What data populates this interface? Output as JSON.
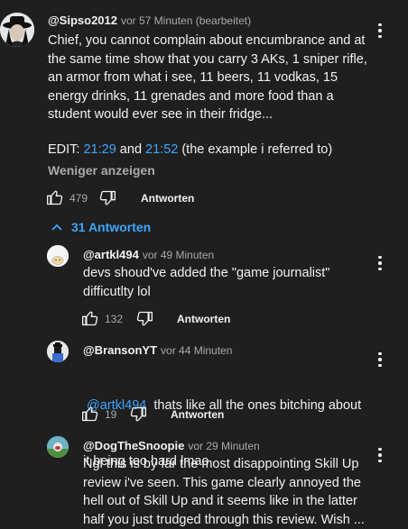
{
  "main_comment": {
    "author": "@Sipso2012",
    "meta": "vor 57 Minuten (bearbeitet)",
    "text_lines": [
      "Chief, you cannot complain about encumbrance and at",
      "the same time show that you carry 3 AKs, 1 sniper rifle,",
      "an armor from what i see, 11 beers, 11 vodkas, 15",
      "energy drinks, 11 grenades and more food than a",
      "student would ever see in their fridge..."
    ],
    "edit_prefix": "EDIT: ",
    "edit_link1": "21:29",
    "edit_and": " and ",
    "edit_link2": "21:52",
    "edit_suffix": " (the example i referred to)",
    "show_less": "Weniger anzeigen",
    "likes": "479",
    "reply_label": "Antworten"
  },
  "replies_toggle": {
    "label": "31 Antworten"
  },
  "replies": [
    {
      "author": "@artkl494",
      "meta": "vor 49 Minuten",
      "text_lines": [
        "devs shoud've added the \"game journalist\"",
        "difficutlty lol"
      ],
      "likes": "132",
      "reply_label": "Antworten"
    },
    {
      "author": "@BransonYT",
      "meta": "vor 44 Minuten",
      "mention": "@artkl494",
      "text_after_mention": "  thats like all the ones bitching about",
      "text_line2": "it being too hard lmao",
      "likes": "19",
      "reply_label": "Antworten"
    },
    {
      "author": "@DogTheSnoopie",
      "meta": "vor 29 Minuten",
      "text_lines": [
        "Ngl this is by far the most disappointing Skill Up",
        "review i've seen. This game clearly annoyed the",
        "hell out of Skill Up and it seems like in the latter",
        "half you just trudged through this review. Wish ..."
      ]
    }
  ],
  "colors": {
    "background": "#1f1f1f",
    "text": "#f1f1f1",
    "secondary": "#aaaaaa",
    "link": "#3ea6ff"
  }
}
